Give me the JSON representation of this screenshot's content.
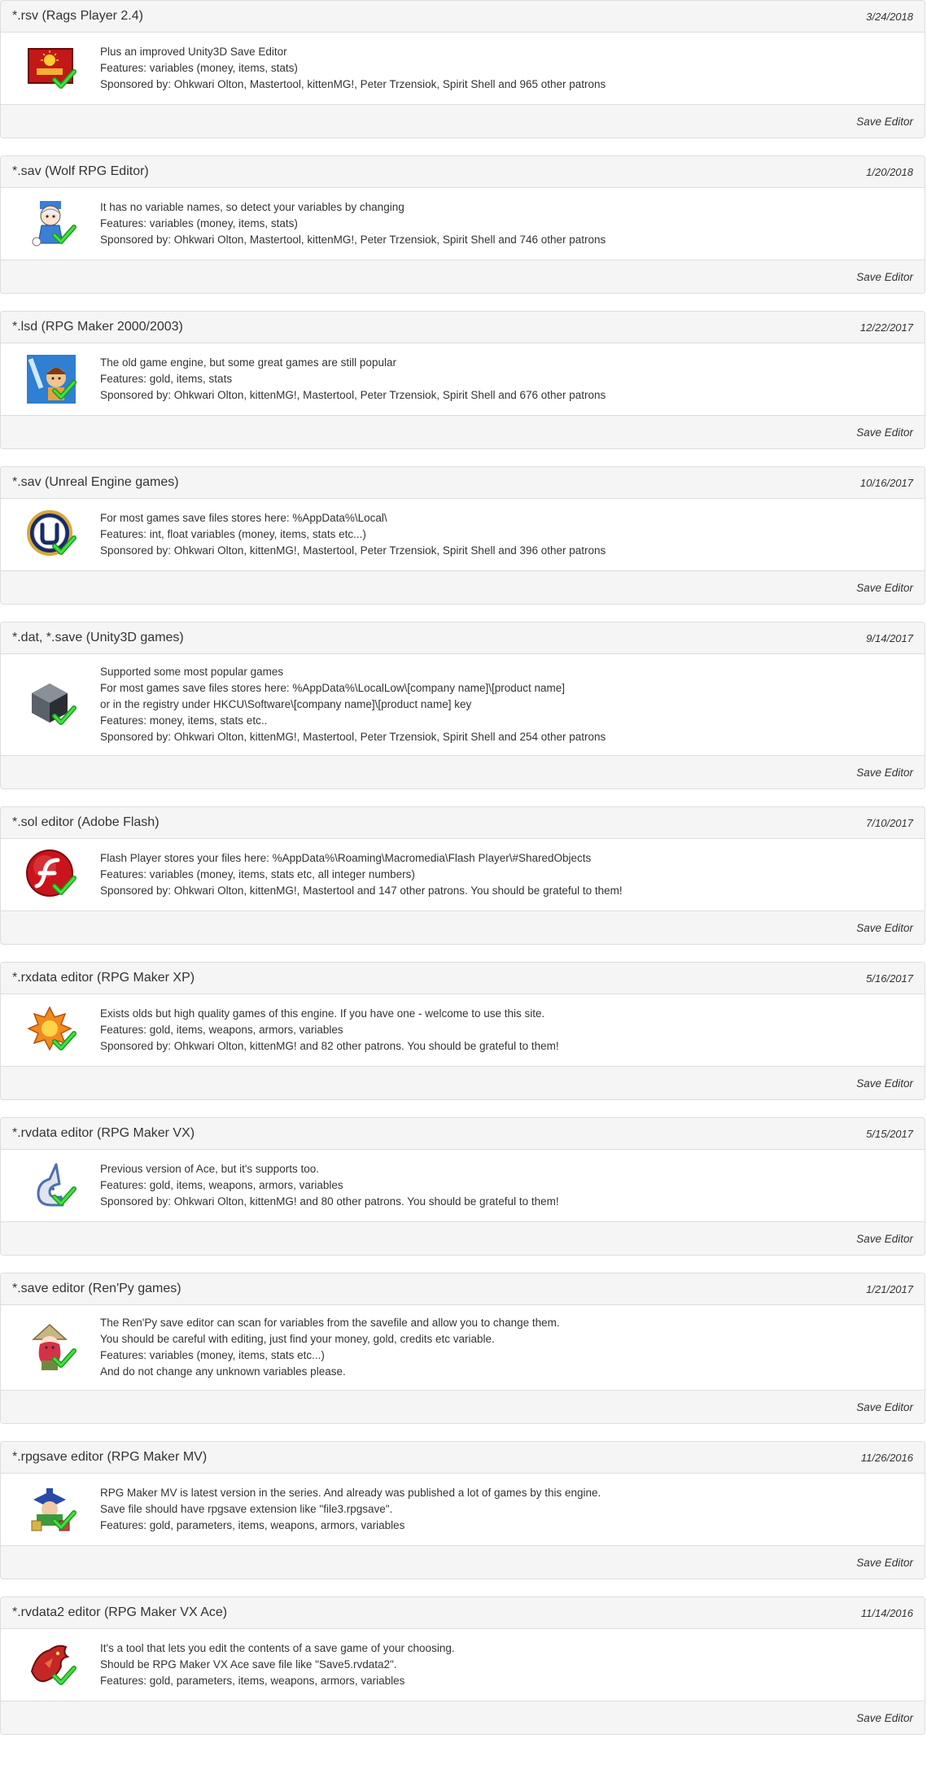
{
  "editors": [
    {
      "title": "*.rsv (Rags Player 2.4)",
      "date": "3/24/2018",
      "icon": "rags-icon",
      "lines": [
        "Plus an improved Unity3D Save Editor",
        "Features: variables (money, items, stats)",
        "Sponsored by: Ohkwari Olton, Mastertool, kittenMG!, Peter Trzensiok, Spirit Shell and 965 other patrons"
      ],
      "link": "Save Editor"
    },
    {
      "title": "*.sav (Wolf RPG Editor)",
      "date": "1/20/2018",
      "icon": "wolf-rpg-icon",
      "lines": [
        "It has no variable names, so detect your variables by changing",
        "Features: variables (money, items, stats)",
        "Sponsored by: Ohkwari Olton, Mastertool, kittenMG!, Peter Trzensiok, Spirit Shell and 746 other patrons"
      ],
      "link": "Save Editor"
    },
    {
      "title": "*.lsd (RPG Maker 2000/2003)",
      "date": "12/22/2017",
      "icon": "rpg-maker-2000-icon",
      "lines": [
        "The old game engine, but some great games are still popular",
        "Features: gold, items, stats",
        "Sponsored by: Ohkwari Olton, kittenMG!, Mastertool, Peter Trzensiok, Spirit Shell and 676 other patrons"
      ],
      "link": "Save Editor"
    },
    {
      "title": "*.sav (Unreal Engine games)",
      "date": "10/16/2017",
      "icon": "unreal-engine-icon",
      "lines": [
        "For most games save files stores here: %AppData%\\Local\\",
        "Features: int, float variables (money, items, stats etc...)",
        "Sponsored by: Ohkwari Olton, kittenMG!, Mastertool, Peter Trzensiok, Spirit Shell and 396 other patrons"
      ],
      "link": "Save Editor"
    },
    {
      "title": "*.dat, *.save (Unity3D games)",
      "date": "9/14/2017",
      "icon": "unity3d-icon",
      "lines": [
        "Supported some most popular games",
        "For most games save files stores here: %AppData%\\LocalLow\\[company name]\\[product name]",
        "or in the registry under HKCU\\Software\\[company name]\\[product name] key",
        "Features: money, items, stats etc..",
        "Sponsored by: Ohkwari Olton, kittenMG!, Mastertool, Peter Trzensiok, Spirit Shell and 254 other patrons"
      ],
      "link": "Save Editor"
    },
    {
      "title": "*.sol editor (Adobe Flash)",
      "date": "7/10/2017",
      "icon": "adobe-flash-icon",
      "lines": [
        "Flash Player stores your files here: %AppData%\\Roaming\\Macromedia\\Flash Player\\#SharedObjects",
        "Features: variables (money, items, stats etc, all integer numbers)",
        "Sponsored by: Ohkwari Olton, kittenMG!, Mastertool and 147 other patrons. You should be grateful to them!"
      ],
      "link": "Save Editor"
    },
    {
      "title": "*.rxdata editor (RPG Maker XP)",
      "date": "5/16/2017",
      "icon": "rpg-maker-xp-icon",
      "lines": [
        "Exists olds but high quality games of this engine. If you have one - welcome to use this site.",
        "Features: gold, items, weapons, armors, variables",
        "Sponsored by: Ohkwari Olton, kittenMG! and 82 other patrons. You should be grateful to them!"
      ],
      "link": "Save Editor"
    },
    {
      "title": "*.rvdata editor (RPG Maker VX)",
      "date": "5/15/2017",
      "icon": "rpg-maker-vx-icon",
      "lines": [
        "Previous version of Ace, but it's supports too.",
        "Features: gold, items, weapons, armors, variables",
        "Sponsored by: Ohkwari Olton, kittenMG! and 80 other patrons. You should be grateful to them!"
      ],
      "link": "Save Editor"
    },
    {
      "title": "*.save editor (Ren'Py games)",
      "date": "1/21/2017",
      "icon": "renpy-icon",
      "lines": [
        "The Ren'Py save editor can scan for variables from the savefile and allow you to change them.",
        "You should be careful with editing, just find your money, gold, credits etc variable.",
        "Features: variables (money, items, stats etc...)",
        "And do not change any unknown variables please."
      ],
      "link": "Save Editor"
    },
    {
      "title": "*.rpgsave editor (RPG Maker MV)",
      "date": "11/26/2016",
      "icon": "rpg-maker-mv-icon",
      "lines": [
        "RPG Maker MV is latest version in the series. And already was published a lot of games by this engine.",
        "Save file should have rpgsave extension like \"file3.rpgsave\".",
        "Features: gold, parameters, items, weapons, armors, variables"
      ],
      "link": "Save Editor"
    },
    {
      "title": "*.rvdata2 editor (RPG Maker VX Ace)",
      "date": "11/14/2016",
      "icon": "rpg-maker-vx-ace-icon",
      "lines": [
        "It's a tool that lets you edit the contents of a save game of your choosing.",
        "Should be RPG Maker VX Ace save file like \"Save5.rvdata2\".",
        "Features: gold, parameters, items, weapons, armors, variables"
      ],
      "link": "Save Editor"
    }
  ]
}
